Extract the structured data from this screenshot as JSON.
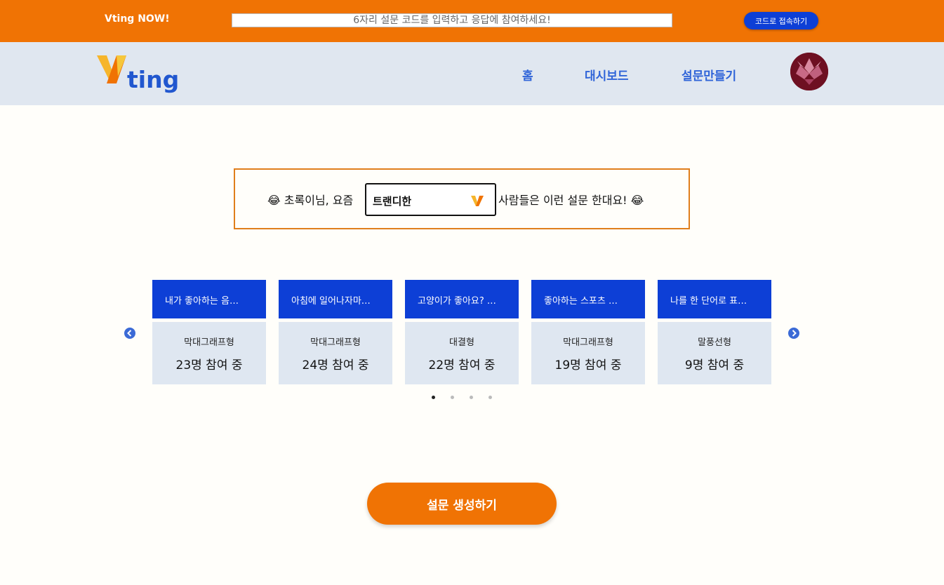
{
  "topbar": {
    "brand_label": "Vting NOW!",
    "code_placeholder": "6자리 설문 코드를 입력하고 응답에 참여하세요!",
    "join_button": "코드로 접속하기",
    "background_color": "#f07304"
  },
  "navbar": {
    "logo_text": "ting",
    "items": [
      {
        "label": "홈"
      },
      {
        "label": "대시보드"
      },
      {
        "label": "설문만들기"
      }
    ],
    "avatar_icon": "avatar-image"
  },
  "trend": {
    "prefix": "😂 초록이님, 요즘",
    "selected": "트랜디한",
    "suffix": "사람들은 이런 설문 한대요! 😂"
  },
  "cards": [
    {
      "title": "내가 좋아하는 음…",
      "type": "막대그래프형",
      "count": "23명 참여 중"
    },
    {
      "title": "아침에 일어나자마…",
      "type": "막대그래프형",
      "count": "24명 참여 중"
    },
    {
      "title": "고양이가 좋아요? …",
      "type": "대결형",
      "count": "22명 참여 중"
    },
    {
      "title": "좋아하는 스포츠 …",
      "type": "막대그래프형",
      "count": "19명 참여 중"
    },
    {
      "title": "나를 한 단어로 표…",
      "type": "말풍선형",
      "count": "9명 참여 중"
    }
  ],
  "carousel": {
    "pages": 4,
    "active_page": 1
  },
  "create_button": "설문 생성하기",
  "colors": {
    "accent_orange": "#f07304",
    "primary_blue": "#0d3fd6",
    "nav_blue": "#2f64d8"
  }
}
